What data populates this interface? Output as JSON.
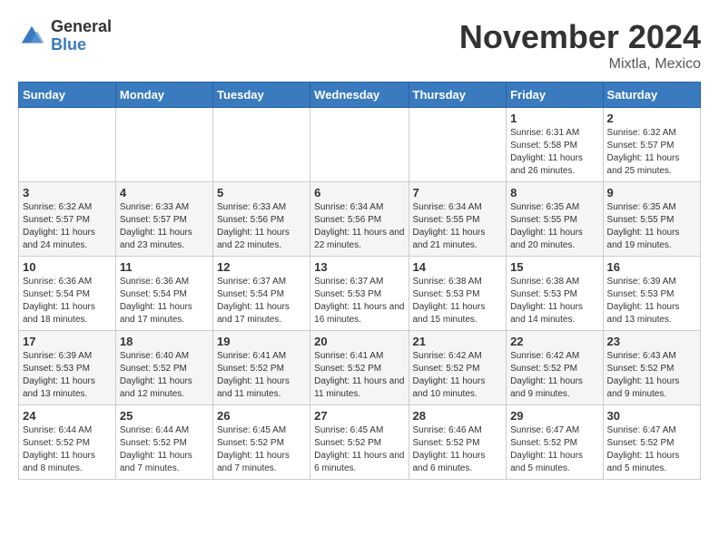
{
  "logo": {
    "general": "General",
    "blue": "Blue"
  },
  "header": {
    "month": "November 2024",
    "location": "Mixtla, Mexico"
  },
  "weekdays": [
    "Sunday",
    "Monday",
    "Tuesday",
    "Wednesday",
    "Thursday",
    "Friday",
    "Saturday"
  ],
  "weeks": [
    [
      {
        "day": "",
        "info": ""
      },
      {
        "day": "",
        "info": ""
      },
      {
        "day": "",
        "info": ""
      },
      {
        "day": "",
        "info": ""
      },
      {
        "day": "",
        "info": ""
      },
      {
        "day": "1",
        "info": "Sunrise: 6:31 AM\nSunset: 5:58 PM\nDaylight: 11 hours and 26 minutes."
      },
      {
        "day": "2",
        "info": "Sunrise: 6:32 AM\nSunset: 5:57 PM\nDaylight: 11 hours and 25 minutes."
      }
    ],
    [
      {
        "day": "3",
        "info": "Sunrise: 6:32 AM\nSunset: 5:57 PM\nDaylight: 11 hours and 24 minutes."
      },
      {
        "day": "4",
        "info": "Sunrise: 6:33 AM\nSunset: 5:57 PM\nDaylight: 11 hours and 23 minutes."
      },
      {
        "day": "5",
        "info": "Sunrise: 6:33 AM\nSunset: 5:56 PM\nDaylight: 11 hours and 22 minutes."
      },
      {
        "day": "6",
        "info": "Sunrise: 6:34 AM\nSunset: 5:56 PM\nDaylight: 11 hours and 22 minutes."
      },
      {
        "day": "7",
        "info": "Sunrise: 6:34 AM\nSunset: 5:55 PM\nDaylight: 11 hours and 21 minutes."
      },
      {
        "day": "8",
        "info": "Sunrise: 6:35 AM\nSunset: 5:55 PM\nDaylight: 11 hours and 20 minutes."
      },
      {
        "day": "9",
        "info": "Sunrise: 6:35 AM\nSunset: 5:55 PM\nDaylight: 11 hours and 19 minutes."
      }
    ],
    [
      {
        "day": "10",
        "info": "Sunrise: 6:36 AM\nSunset: 5:54 PM\nDaylight: 11 hours and 18 minutes."
      },
      {
        "day": "11",
        "info": "Sunrise: 6:36 AM\nSunset: 5:54 PM\nDaylight: 11 hours and 17 minutes."
      },
      {
        "day": "12",
        "info": "Sunrise: 6:37 AM\nSunset: 5:54 PM\nDaylight: 11 hours and 17 minutes."
      },
      {
        "day": "13",
        "info": "Sunrise: 6:37 AM\nSunset: 5:53 PM\nDaylight: 11 hours and 16 minutes."
      },
      {
        "day": "14",
        "info": "Sunrise: 6:38 AM\nSunset: 5:53 PM\nDaylight: 11 hours and 15 minutes."
      },
      {
        "day": "15",
        "info": "Sunrise: 6:38 AM\nSunset: 5:53 PM\nDaylight: 11 hours and 14 minutes."
      },
      {
        "day": "16",
        "info": "Sunrise: 6:39 AM\nSunset: 5:53 PM\nDaylight: 11 hours and 13 minutes."
      }
    ],
    [
      {
        "day": "17",
        "info": "Sunrise: 6:39 AM\nSunset: 5:53 PM\nDaylight: 11 hours and 13 minutes."
      },
      {
        "day": "18",
        "info": "Sunrise: 6:40 AM\nSunset: 5:52 PM\nDaylight: 11 hours and 12 minutes."
      },
      {
        "day": "19",
        "info": "Sunrise: 6:41 AM\nSunset: 5:52 PM\nDaylight: 11 hours and 11 minutes."
      },
      {
        "day": "20",
        "info": "Sunrise: 6:41 AM\nSunset: 5:52 PM\nDaylight: 11 hours and 11 minutes."
      },
      {
        "day": "21",
        "info": "Sunrise: 6:42 AM\nSunset: 5:52 PM\nDaylight: 11 hours and 10 minutes."
      },
      {
        "day": "22",
        "info": "Sunrise: 6:42 AM\nSunset: 5:52 PM\nDaylight: 11 hours and 9 minutes."
      },
      {
        "day": "23",
        "info": "Sunrise: 6:43 AM\nSunset: 5:52 PM\nDaylight: 11 hours and 9 minutes."
      }
    ],
    [
      {
        "day": "24",
        "info": "Sunrise: 6:44 AM\nSunset: 5:52 PM\nDaylight: 11 hours and 8 minutes."
      },
      {
        "day": "25",
        "info": "Sunrise: 6:44 AM\nSunset: 5:52 PM\nDaylight: 11 hours and 7 minutes."
      },
      {
        "day": "26",
        "info": "Sunrise: 6:45 AM\nSunset: 5:52 PM\nDaylight: 11 hours and 7 minutes."
      },
      {
        "day": "27",
        "info": "Sunrise: 6:45 AM\nSunset: 5:52 PM\nDaylight: 11 hours and 6 minutes."
      },
      {
        "day": "28",
        "info": "Sunrise: 6:46 AM\nSunset: 5:52 PM\nDaylight: 11 hours and 6 minutes."
      },
      {
        "day": "29",
        "info": "Sunrise: 6:47 AM\nSunset: 5:52 PM\nDaylight: 11 hours and 5 minutes."
      },
      {
        "day": "30",
        "info": "Sunrise: 6:47 AM\nSunset: 5:52 PM\nDaylight: 11 hours and 5 minutes."
      }
    ]
  ]
}
